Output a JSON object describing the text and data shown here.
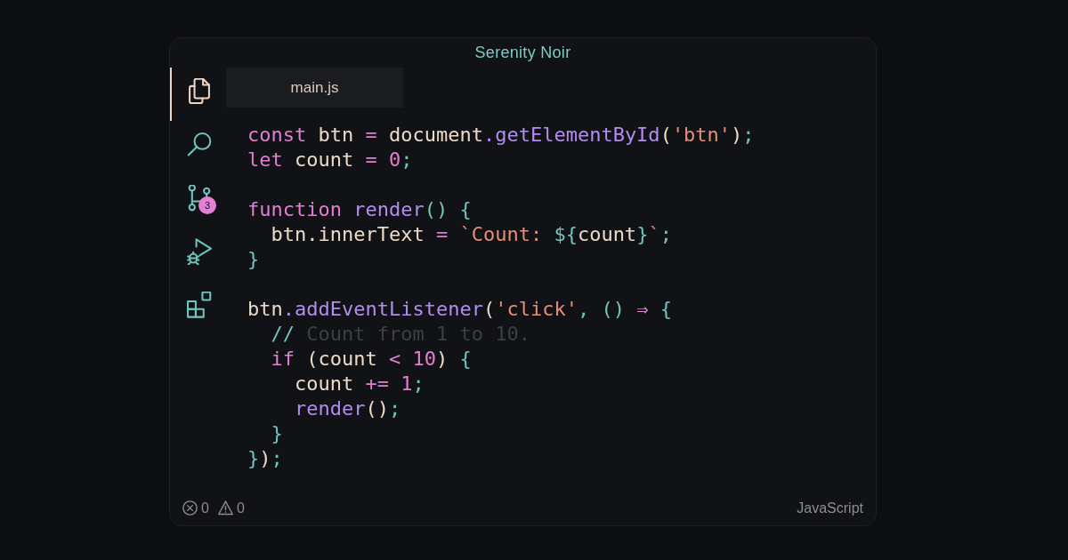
{
  "window": {
    "title": "Serenity Noir"
  },
  "activity_bar": {
    "items": [
      {
        "kind": "files",
        "selected": true
      },
      {
        "kind": "search",
        "selected": false
      },
      {
        "kind": "branch",
        "selected": false,
        "badge": "3"
      },
      {
        "kind": "debug",
        "selected": false
      },
      {
        "kind": "extensions",
        "selected": false
      }
    ]
  },
  "tabs": [
    {
      "label": "main.js",
      "selected": true
    }
  ],
  "editor": {
    "lines": [
      {
        "kind": "code",
        "tokens": [
          {
            "kind": "keyword",
            "text": "const"
          },
          {
            "kind": "plain",
            "text": " btn "
          },
          {
            "kind": "keyword",
            "text": "="
          },
          {
            "kind": "plain",
            "text": " document"
          },
          {
            "kind": "function",
            "text": ".getElementById"
          },
          {
            "kind": "plain",
            "text": "("
          },
          {
            "kind": "string",
            "text": "'btn'"
          },
          {
            "kind": "plain",
            "text": ")"
          },
          {
            "kind": "punct",
            "text": ";"
          }
        ]
      },
      {
        "kind": "code",
        "tokens": [
          {
            "kind": "keyword",
            "text": "let"
          },
          {
            "kind": "plain",
            "text": " count "
          },
          {
            "kind": "keyword",
            "text": "= 0"
          },
          {
            "kind": "punct",
            "text": ";"
          }
        ]
      },
      {
        "kind": "blank"
      },
      {
        "kind": "code",
        "tokens": [
          {
            "kind": "keyword",
            "text": "function "
          },
          {
            "kind": "function",
            "text": "render"
          },
          {
            "kind": "punct",
            "text": "() {"
          }
        ],
        "children": [
          {
            "kind": "code",
            "tokens": [
              {
                "kind": "plain",
                "text": "btn.innerText "
              },
              {
                "kind": "keyword",
                "text": "= "
              },
              {
                "kind": "string",
                "text": "`Count: "
              },
              {
                "kind": "punct",
                "text": "${"
              },
              {
                "kind": "plain",
                "text": "count"
              },
              {
                "kind": "punct",
                "text": "}"
              },
              {
                "kind": "string",
                "text": "`"
              },
              {
                "kind": "punct",
                "text": ";"
              }
            ]
          }
        ]
      },
      {
        "kind": "code",
        "tokens": [
          {
            "kind": "punct",
            "text": "}"
          }
        ]
      },
      {
        "kind": "blank"
      },
      {
        "kind": "code",
        "tokens": [
          {
            "kind": "plain",
            "text": "btn"
          },
          {
            "kind": "function",
            "text": ".addEventListener"
          },
          {
            "kind": "plain",
            "text": "("
          },
          {
            "kind": "string",
            "text": "'click'"
          },
          {
            "kind": "punct",
            "text": ", () "
          },
          {
            "kind": "keyword",
            "text": "⇒ "
          },
          {
            "kind": "punct",
            "text": "{"
          }
        ],
        "children": [
          {
            "kind": "code",
            "tokens": [
              {
                "kind": "punct",
                "text": "//"
              },
              {
                "kind": "comment",
                "text": " Count from 1 to 10."
              }
            ]
          },
          {
            "kind": "code",
            "tokens": [
              {
                "kind": "keyword",
                "text": "if"
              },
              {
                "kind": "plain",
                "text": " (count "
              },
              {
                "kind": "keyword",
                "text": "< 10"
              },
              {
                "kind": "plain",
                "text": ") "
              },
              {
                "kind": "punct",
                "text": "{"
              }
            ],
            "children": [
              {
                "kind": "code",
                "tokens": [
                  {
                    "kind": "plain",
                    "text": "count "
                  },
                  {
                    "kind": "keyword",
                    "text": "+= 1"
                  },
                  {
                    "kind": "punct",
                    "text": ";"
                  }
                ]
              },
              {
                "kind": "code",
                "tokens": [
                  {
                    "kind": "function",
                    "text": "render"
                  },
                  {
                    "kind": "plain",
                    "text": "()"
                  },
                  {
                    "kind": "punct",
                    "text": ";"
                  }
                ]
              }
            ]
          },
          {
            "kind": "code",
            "tokens": [
              {
                "kind": "punct",
                "text": "}"
              }
            ]
          }
        ]
      },
      {
        "kind": "code",
        "tokens": [
          {
            "kind": "punct",
            "text": "}"
          },
          {
            "kind": "plain",
            "text": ")"
          },
          {
            "kind": "punct",
            "text": ";"
          }
        ]
      }
    ]
  },
  "status_bar": {
    "errors": "0",
    "warnings": "0",
    "language": "JavaScript"
  }
}
